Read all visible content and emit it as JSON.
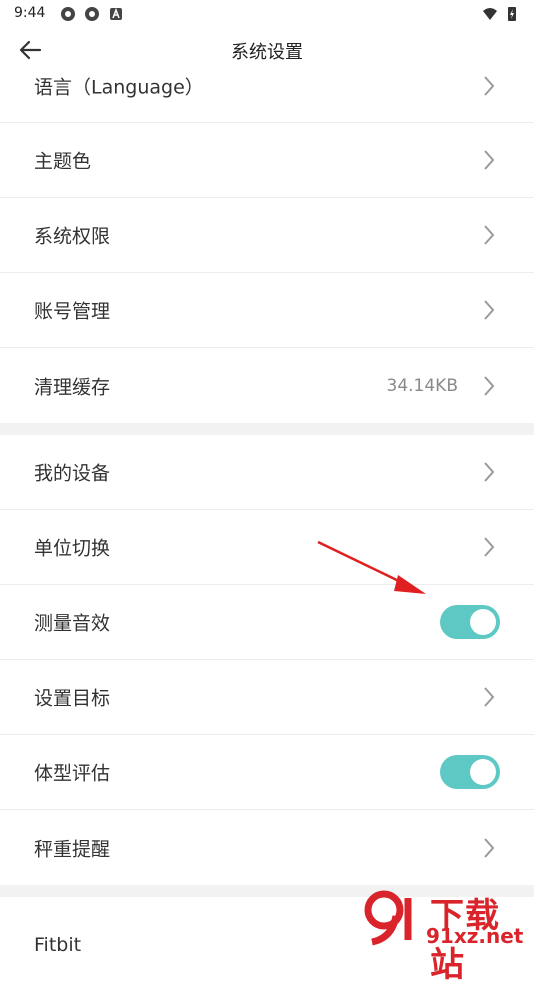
{
  "status_bar": {
    "time": "9:44"
  },
  "header": {
    "title": "系统设置"
  },
  "settings_group_1": [
    {
      "label": "语言（Language）",
      "type": "link"
    },
    {
      "label": "主题色",
      "type": "link"
    },
    {
      "label": "系统权限",
      "type": "link"
    },
    {
      "label": "账号管理",
      "type": "link"
    },
    {
      "label": "清理缓存",
      "type": "link",
      "value": "34.14KB"
    }
  ],
  "settings_group_2": [
    {
      "label": "我的设备",
      "type": "link"
    },
    {
      "label": "单位切换",
      "type": "link"
    },
    {
      "label": "测量音效",
      "type": "toggle",
      "on": true
    },
    {
      "label": "设置目标",
      "type": "link"
    },
    {
      "label": "体型评估",
      "type": "toggle",
      "on": true
    },
    {
      "label": "秤重提醒",
      "type": "link"
    }
  ],
  "settings_group_3": [
    {
      "label": "Fitbit",
      "type": "link"
    }
  ],
  "colors": {
    "toggle_on": "#5ec9c4",
    "annotation_arrow": "#e02020",
    "watermark": "#d8242a"
  },
  "watermark": {
    "site_name": "下载站",
    "url": "91xz.net"
  }
}
